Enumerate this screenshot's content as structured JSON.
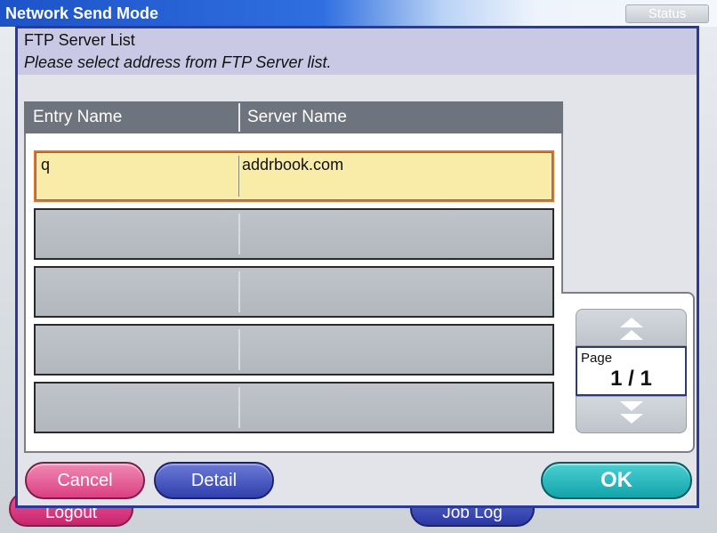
{
  "window": {
    "title": "Network Send Mode",
    "status_label": "Status"
  },
  "background_buttons": {
    "logout_label": "Logout",
    "job_log_label": "Job Log"
  },
  "dialog": {
    "title": "FTP Server List",
    "subtitle": "Please select address from FTP Server list."
  },
  "table": {
    "columns": [
      "Entry Name",
      "Server Name"
    ],
    "rows": [
      {
        "entry": "q",
        "server": "addrbook.com",
        "selected": true
      },
      {
        "entry": "",
        "server": "",
        "selected": false
      },
      {
        "entry": "",
        "server": "",
        "selected": false
      },
      {
        "entry": "",
        "server": "",
        "selected": false
      },
      {
        "entry": "",
        "server": "",
        "selected": false
      }
    ]
  },
  "pager": {
    "label": "Page",
    "value": "1 / 1",
    "up_icon": "up-double-arrow-icon",
    "down_icon": "down-double-arrow-icon"
  },
  "actions": {
    "cancel_label": "Cancel",
    "detail_label": "Detail",
    "ok_label": "OK"
  },
  "colors": {
    "selected_row": "#f8eca8",
    "cancel": "#dc3f82",
    "detail": "#3140ac",
    "ok": "#13a4aa"
  }
}
